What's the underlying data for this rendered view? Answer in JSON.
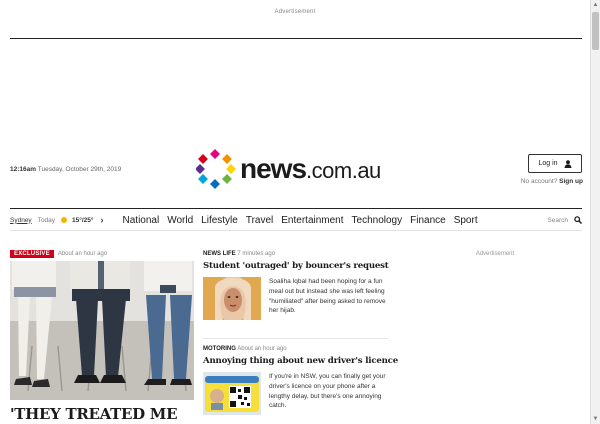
{
  "ads": {
    "top_label": "Advertisement",
    "side_label": "Advertisement"
  },
  "header": {
    "time": "12:16am",
    "date": "Tuesday, October 29th, 2019",
    "brand": "news",
    "brand_suffix": ".com.au",
    "login_label": "Log in",
    "login_icon": "user-icon",
    "no_account": "No account?",
    "signup_label": "Sign up"
  },
  "weather": {
    "city": "Sydney",
    "day": "Today",
    "temps": "15°/25°",
    "icon": "sun-icon",
    "icon_color": "#f6b400"
  },
  "nav": {
    "items": [
      "National",
      "World",
      "Lifestyle",
      "Travel",
      "Entertainment",
      "Technology",
      "Finance",
      "Sport"
    ],
    "search_label": "Search",
    "search_icon": "search-icon"
  },
  "hero": {
    "badge": "EXCLUSIVE",
    "badge_color": "#d0021b",
    "time": "About an hour ago",
    "headline": "'THEY TREATED ME"
  },
  "stories": [
    {
      "section": "NEWS LIFE",
      "time": "7 minutes ago",
      "title": "Student 'outraged' by bouncer's request",
      "summary": "Soaliha Iqbal had been hoping for a fun meal out but instead she was left feeling \"humiliated\" after being asked to remove her hijab."
    },
    {
      "section": "MOTORING",
      "time": "About an hour ago",
      "title": "Annoying thing about new driver's licence",
      "summary": "If you're in NSW, you can finally get your driver's licence on your phone after a lengthy delay, but there's one annoying catch."
    }
  ]
}
